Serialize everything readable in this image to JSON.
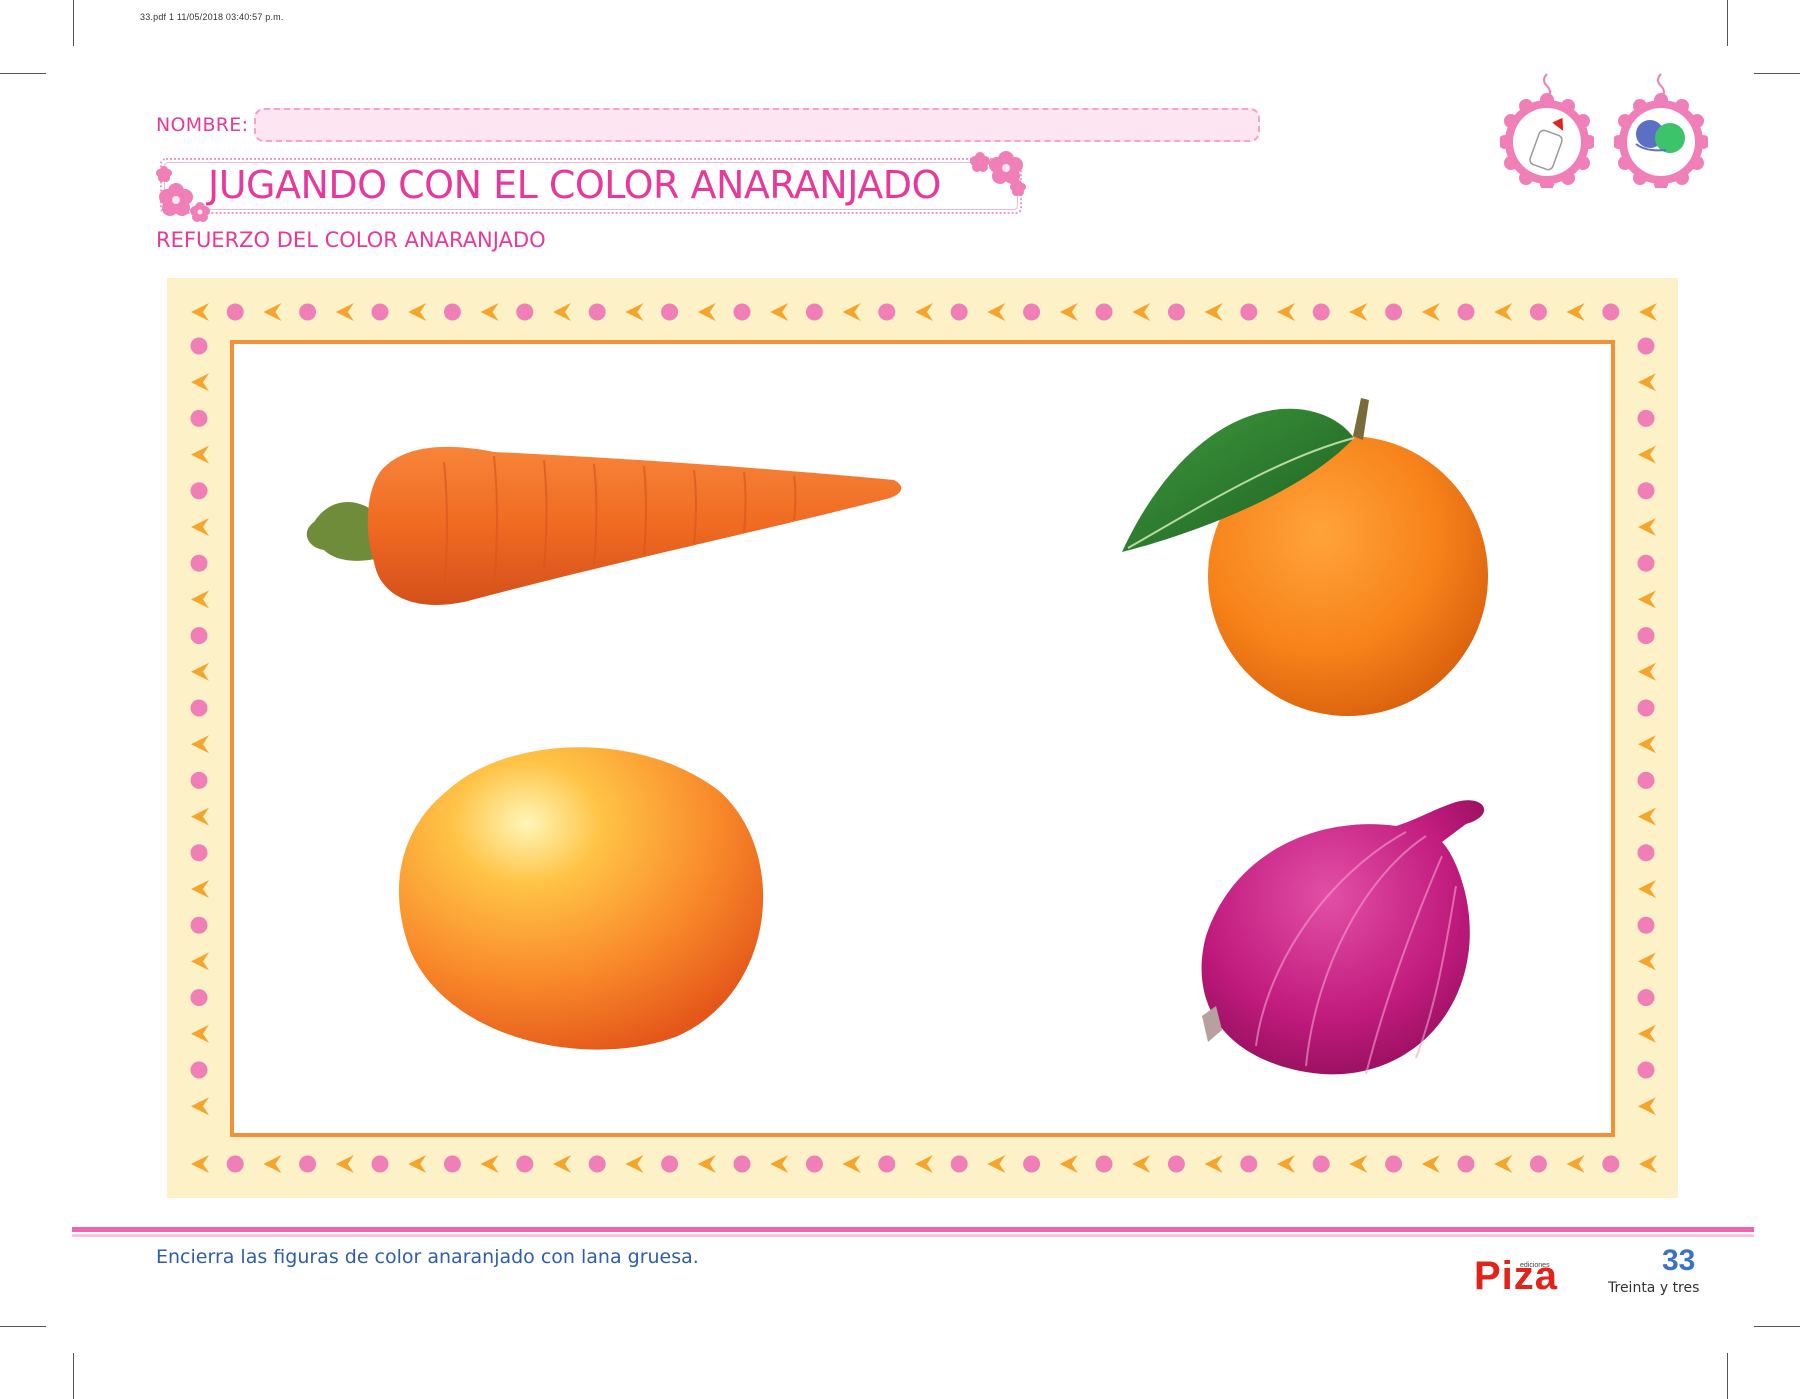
{
  "file_info": "33.pdf   1   11/05/2018   03:40:57 p.m.",
  "header": {
    "name_label": "NOMBRE:",
    "title": "JUGANDO CON EL COLOR ANARANJADO",
    "subtitle": "REFUERZO DEL COLOR ANARANJADO"
  },
  "material_icons": [
    "glue-bottle-icon",
    "yarn-balls-icon"
  ],
  "items": [
    {
      "name": "carrot",
      "color": "orange"
    },
    {
      "name": "orange",
      "color": "orange"
    },
    {
      "name": "mango",
      "color": "orange"
    },
    {
      "name": "red-onion",
      "color": "purple"
    }
  ],
  "footer": {
    "instruction": "Encierra las figuras de color anaranjado con lana gruesa.",
    "brand_small": "ediciones",
    "brand": "Piza",
    "page_number": "33",
    "page_words": "Treinta y tres"
  },
  "colors": {
    "accent_pink": "#e6399b",
    "frame_yellow": "#fdf1c7",
    "frame_orange": "#f29138",
    "instruction_blue": "#2f5ea8",
    "brand_red": "#e2231a"
  }
}
